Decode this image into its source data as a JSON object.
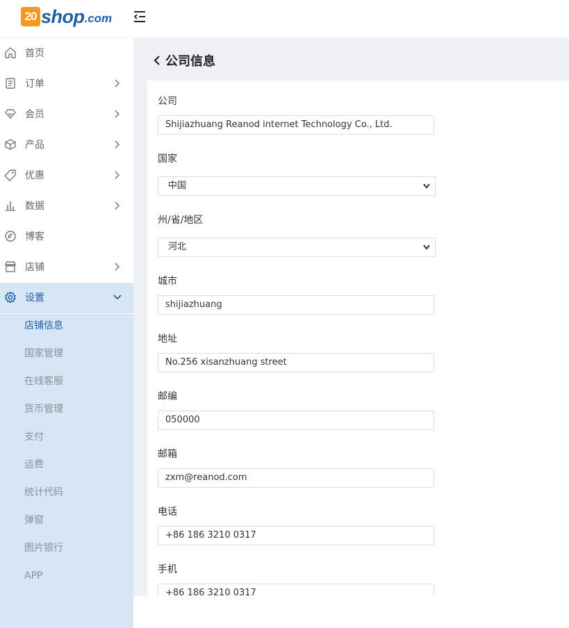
{
  "brand": {
    "logo_badge": "20",
    "logo_word": "shop",
    "logo_suffix": ".com"
  },
  "sidebar": {
    "items": [
      {
        "label": "首页",
        "icon": "home-icon",
        "has_chevron": false
      },
      {
        "label": "订单",
        "icon": "order-icon",
        "has_chevron": true
      },
      {
        "label": "会员",
        "icon": "member-icon",
        "has_chevron": true
      },
      {
        "label": "产品",
        "icon": "product-box-icon",
        "has_chevron": true
      },
      {
        "label": "优惠",
        "icon": "tag-icon",
        "has_chevron": true
      },
      {
        "label": "数据",
        "icon": "bar-chart-icon",
        "has_chevron": true
      },
      {
        "label": "博客",
        "icon": "blog-icon",
        "has_chevron": false
      },
      {
        "label": "店铺",
        "icon": "store-icon",
        "has_chevron": true
      },
      {
        "label": "设置",
        "icon": "gear-icon",
        "has_chevron": true,
        "expanded": true
      }
    ],
    "submenu": [
      {
        "label": "店铺信息",
        "current": true
      },
      {
        "label": "国家管理"
      },
      {
        "label": "在线客服"
      },
      {
        "label": "货币管理"
      },
      {
        "label": "支付"
      },
      {
        "label": "运费"
      },
      {
        "label": "统计代码"
      },
      {
        "label": "弹窗"
      },
      {
        "label": "图片银行"
      },
      {
        "label": "APP"
      }
    ]
  },
  "page": {
    "title": "公司信息"
  },
  "form": {
    "company": {
      "label": "公司",
      "value": "Shijiazhuang Reanod internet Technology Co., Ltd."
    },
    "country": {
      "label": "国家",
      "value": "中国"
    },
    "province": {
      "label": "州/省/地区",
      "value": "河北"
    },
    "city": {
      "label": "城市",
      "value": "shijiazhuang"
    },
    "address": {
      "label": "地址",
      "value": "No.256 xisanzhuang street"
    },
    "zip": {
      "label": "邮编",
      "value": "050000"
    },
    "email": {
      "label": "邮箱",
      "value": "zxm@reanod.com"
    },
    "phone": {
      "label": "电话",
      "value": "+86 186 3210 0317"
    },
    "mobile": {
      "label": "手机",
      "value": "+86 186 3210 0317"
    }
  },
  "colors": {
    "accent": "#1f5fa8",
    "logo_orange": "#f39a1e",
    "submenu_bg": "#d6e6f5",
    "content_bg": "#eef0f5"
  }
}
